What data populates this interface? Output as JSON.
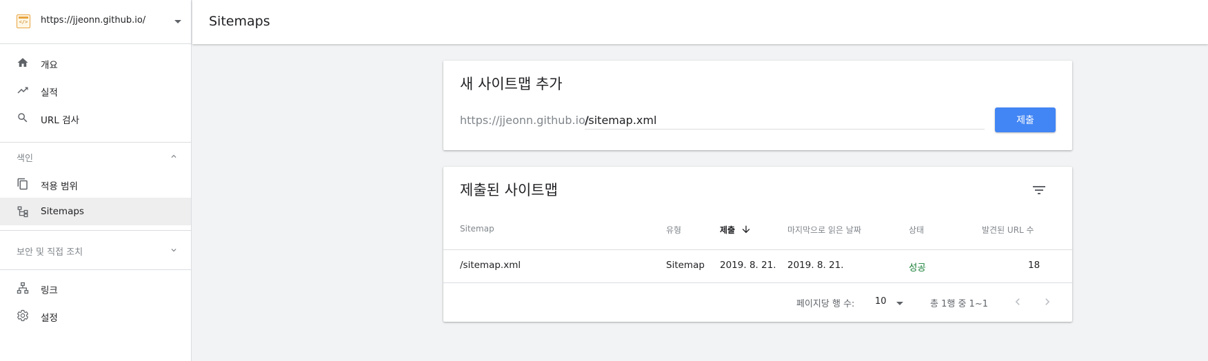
{
  "sidebar": {
    "property_url": "https://jjeonn.github.io/",
    "property_icon": "code-file-icon",
    "items_top": [
      {
        "label": "개요",
        "icon": "home-icon"
      },
      {
        "label": "실적",
        "icon": "trending-up-icon"
      },
      {
        "label": "URL 검사",
        "icon": "search-icon"
      }
    ],
    "section_index": {
      "label": "색인",
      "expanded": true
    },
    "items_index": [
      {
        "label": "적용 범위",
        "icon": "copy-icon"
      },
      {
        "label": "Sitemaps",
        "icon": "sitemap-icon",
        "active": true
      }
    ],
    "section_security": {
      "label": "보안 및 직접 조치",
      "expanded": false
    },
    "items_bottom": [
      {
        "label": "링크",
        "icon": "links-icon"
      },
      {
        "label": "설정",
        "icon": "gear-icon"
      }
    ]
  },
  "header": {
    "title": "Sitemaps"
  },
  "add_card": {
    "title": "새 사이트맵 추가",
    "prefix": "https://jjeonn.github.io/",
    "input_value": "/sitemap.xml",
    "submit_label": "제출"
  },
  "submitted_card": {
    "title": "제출된 사이트맵",
    "columns": [
      "Sitemap",
      "유형",
      "제출",
      "마지막으로 읽은 날짜",
      "상태",
      "발견된 URL 수"
    ],
    "sorted_column": "제출",
    "rows": [
      {
        "sitemap": "/sitemap.xml",
        "type": "Sitemap",
        "submitted": "2019. 8. 21.",
        "last_read": "2019. 8. 21.",
        "status": "성공",
        "urls": "18"
      }
    ],
    "pagination": {
      "rows_per_page_label": "페이지당 행 수:",
      "rows_per_page": "10",
      "range": "총 1행 중 1~1"
    }
  },
  "colors": {
    "accent": "#4285f4",
    "success": "#188038"
  }
}
